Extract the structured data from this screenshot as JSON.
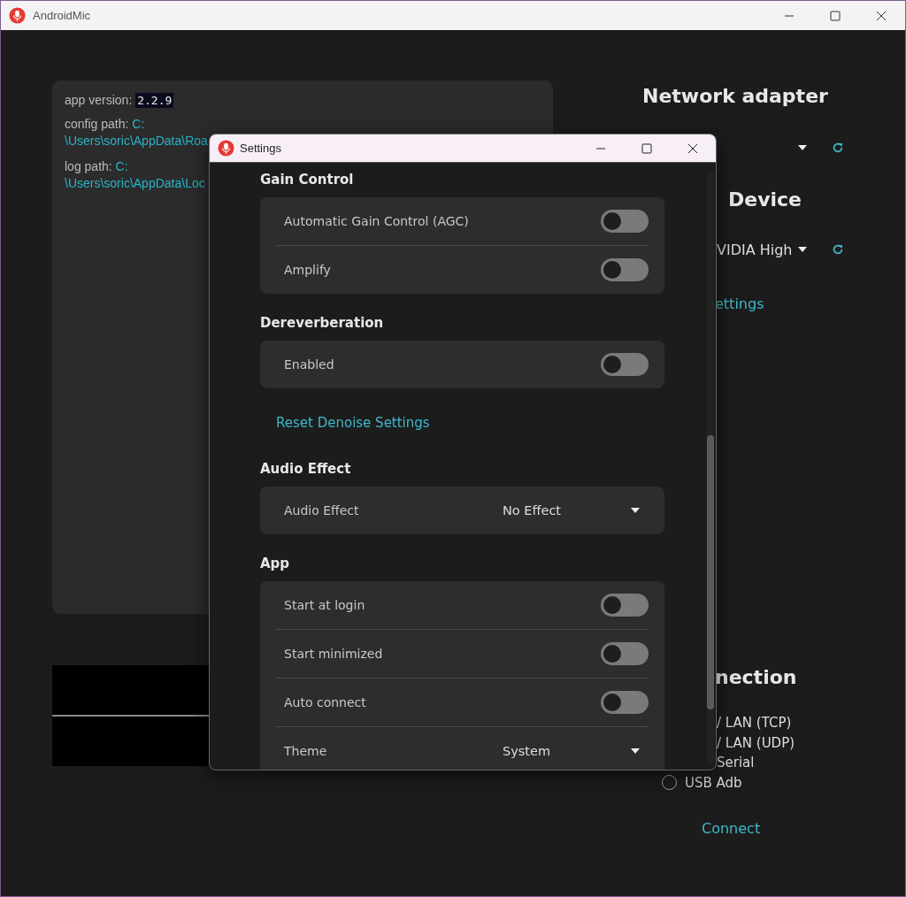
{
  "window": {
    "title": "AndroidMic"
  },
  "info_panel": {
    "version_label": "app version:",
    "version": "2.2.9",
    "config_label": "config path:",
    "config_path_start": "C:",
    "config_path_rest": "\\Users\\soric\\AppData\\Roa",
    "log_label": "log path:",
    "log_path_start": "C:",
    "log_path_rest": "\\Users\\soric\\AppData\\Loc"
  },
  "network_adapter": {
    "title": "Network adapter"
  },
  "audio_device": {
    "title": "Device",
    "value": "VIDIA High",
    "settings_link": "ettings"
  },
  "connection": {
    "title": "nection",
    "options": [
      {
        "label": "/ LAN (TCP)"
      },
      {
        "label": "/ LAN (UDP)"
      },
      {
        "label": "Serial"
      },
      {
        "label": "USB Adb",
        "selected": false
      }
    ],
    "connect": "Connect"
  },
  "settings": {
    "title": "Settings",
    "items": [
      {
        "kind": "section",
        "title": "Gain Control",
        "rows": [
          {
            "kind": "toggle",
            "label": "Automatic Gain Control (AGC)",
            "on": false
          },
          {
            "kind": "toggle",
            "label": "Amplify",
            "on": false
          }
        ]
      },
      {
        "kind": "section",
        "title": "Dereverberation",
        "rows": [
          {
            "kind": "toggle",
            "label": "Enabled",
            "on": false
          }
        ]
      },
      {
        "kind": "link",
        "label": "Reset Denoise Settings"
      },
      {
        "kind": "section",
        "title": "Audio Effect",
        "rows": [
          {
            "kind": "select",
            "label": "Audio Effect",
            "value": "No Effect"
          }
        ]
      },
      {
        "kind": "section",
        "title": "App",
        "rows": [
          {
            "kind": "toggle",
            "label": "Start at login",
            "on": false
          },
          {
            "kind": "toggle",
            "label": "Start minimized",
            "on": false
          },
          {
            "kind": "toggle",
            "label": "Auto connect",
            "on": false
          },
          {
            "kind": "select",
            "label": "Theme",
            "value": "System"
          }
        ]
      }
    ]
  }
}
